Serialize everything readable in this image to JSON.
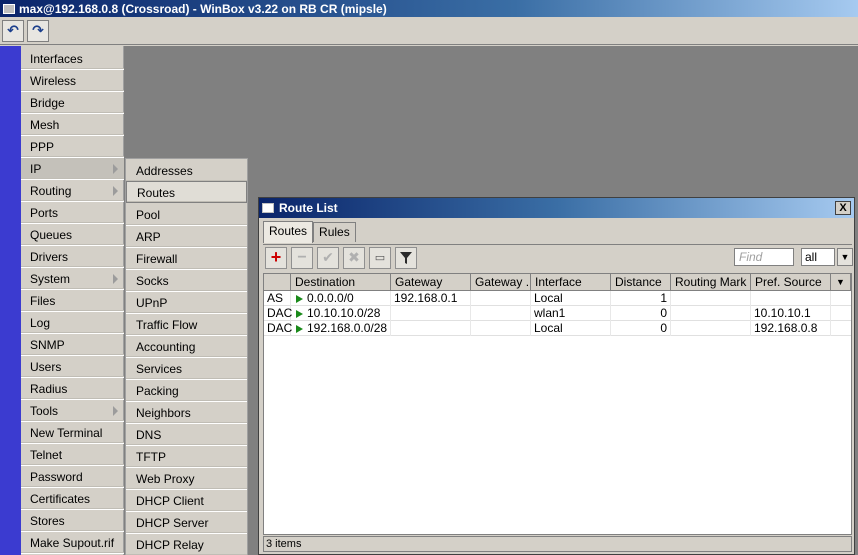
{
  "window_title": "max@192.168.0.8 (Crossroad) - WinBox v3.22 on RB CR (mipsle)",
  "toolbar": {
    "undo_icon": "undo-icon",
    "redo_icon": "redo-icon"
  },
  "menu": [
    {
      "label": "Interfaces",
      "submenu": false
    },
    {
      "label": "Wireless",
      "submenu": false
    },
    {
      "label": "Bridge",
      "submenu": false
    },
    {
      "label": "Mesh",
      "submenu": false
    },
    {
      "label": "PPP",
      "submenu": false
    },
    {
      "label": "IP",
      "submenu": true
    },
    {
      "label": "Routing",
      "submenu": true
    },
    {
      "label": "Ports",
      "submenu": false
    },
    {
      "label": "Queues",
      "submenu": false
    },
    {
      "label": "Drivers",
      "submenu": false
    },
    {
      "label": "System",
      "submenu": true
    },
    {
      "label": "Files",
      "submenu": false
    },
    {
      "label": "Log",
      "submenu": false
    },
    {
      "label": "SNMP",
      "submenu": false
    },
    {
      "label": "Users",
      "submenu": false
    },
    {
      "label": "Radius",
      "submenu": false
    },
    {
      "label": "Tools",
      "submenu": true
    },
    {
      "label": "New Terminal",
      "submenu": false
    },
    {
      "label": "Telnet",
      "submenu": false
    },
    {
      "label": "Password",
      "submenu": false
    },
    {
      "label": "Certificates",
      "submenu": false
    },
    {
      "label": "Stores",
      "submenu": false
    },
    {
      "label": "Make Supout.rif",
      "submenu": false
    }
  ],
  "ip_submenu": [
    "Addresses",
    "Routes",
    "Pool",
    "ARP",
    "Firewall",
    "Socks",
    "UPnP",
    "Traffic Flow",
    "Accounting",
    "Services",
    "Packing",
    "Neighbors",
    "DNS",
    "TFTP",
    "Web Proxy",
    "DHCP Client",
    "DHCP Server",
    "DHCP Relay"
  ],
  "route_list": {
    "title": "Route List",
    "close": "X",
    "tabs": [
      "Routes",
      "Rules"
    ],
    "find_placeholder": "Find",
    "filter_value": "all",
    "columns": [
      "",
      "Destination",
      "Gateway",
      "Gateway ...",
      "Interface",
      "Distance",
      "Routing Mark",
      "Pref. Source"
    ],
    "rows": [
      {
        "flags": "AS",
        "destination": "0.0.0.0/0",
        "gateway": "192.168.0.1",
        "gateway_status": "",
        "interface": "Local",
        "distance": "1",
        "routing_mark": "",
        "pref_source": ""
      },
      {
        "flags": "DAC",
        "destination": "10.10.10.0/28",
        "gateway": "",
        "gateway_status": "",
        "interface": "wlan1",
        "distance": "0",
        "routing_mark": "",
        "pref_source": "10.10.10.1"
      },
      {
        "flags": "DAC",
        "destination": "192.168.0.0/28",
        "gateway": "",
        "gateway_status": "",
        "interface": "Local",
        "distance": "0",
        "routing_mark": "",
        "pref_source": "192.168.0.8"
      }
    ],
    "status": "3 items"
  },
  "colors": {
    "title_bar": "#0a246a",
    "left_strip": "#3b3bd0",
    "workspace": "#808080",
    "add_icon": "#cc0000",
    "active_flag": "#1a8a1a"
  }
}
